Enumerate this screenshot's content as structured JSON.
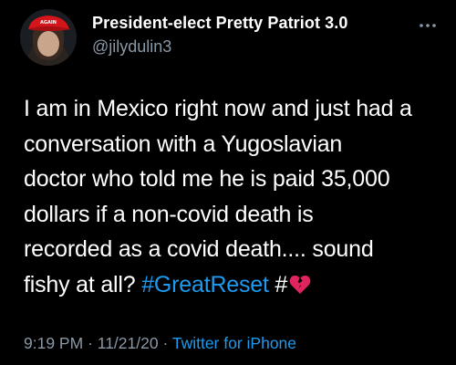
{
  "tweet": {
    "display_name": "President-elect Pretty Patriot 3.0",
    "handle": "@jilydulin3",
    "avatar_hat_text": "AGAIN",
    "body_lines": [
      "I am in Mexico right now and just had a",
      "conversation with a Yugoslavian",
      "doctor who told me he is paid 35,000",
      "dollars if a non-covid death is",
      "recorded as a covid death.... sound"
    ],
    "last_line_text": "fishy at all? ",
    "hashtag_1": "#GreatReset",
    "hashtag_2": "#",
    "time": "9:19 PM",
    "date": "11/21/20",
    "separator": "·",
    "source": "Twitter for iPhone"
  },
  "colors": {
    "background": "#000000",
    "text": "#ffffff",
    "secondary_text": "#8b98a5",
    "link": "#1d9bf0",
    "broken_heart": "#e0245e"
  },
  "icons": {
    "more": "more-horizontal-icon",
    "emoji": "broken-heart-icon"
  }
}
